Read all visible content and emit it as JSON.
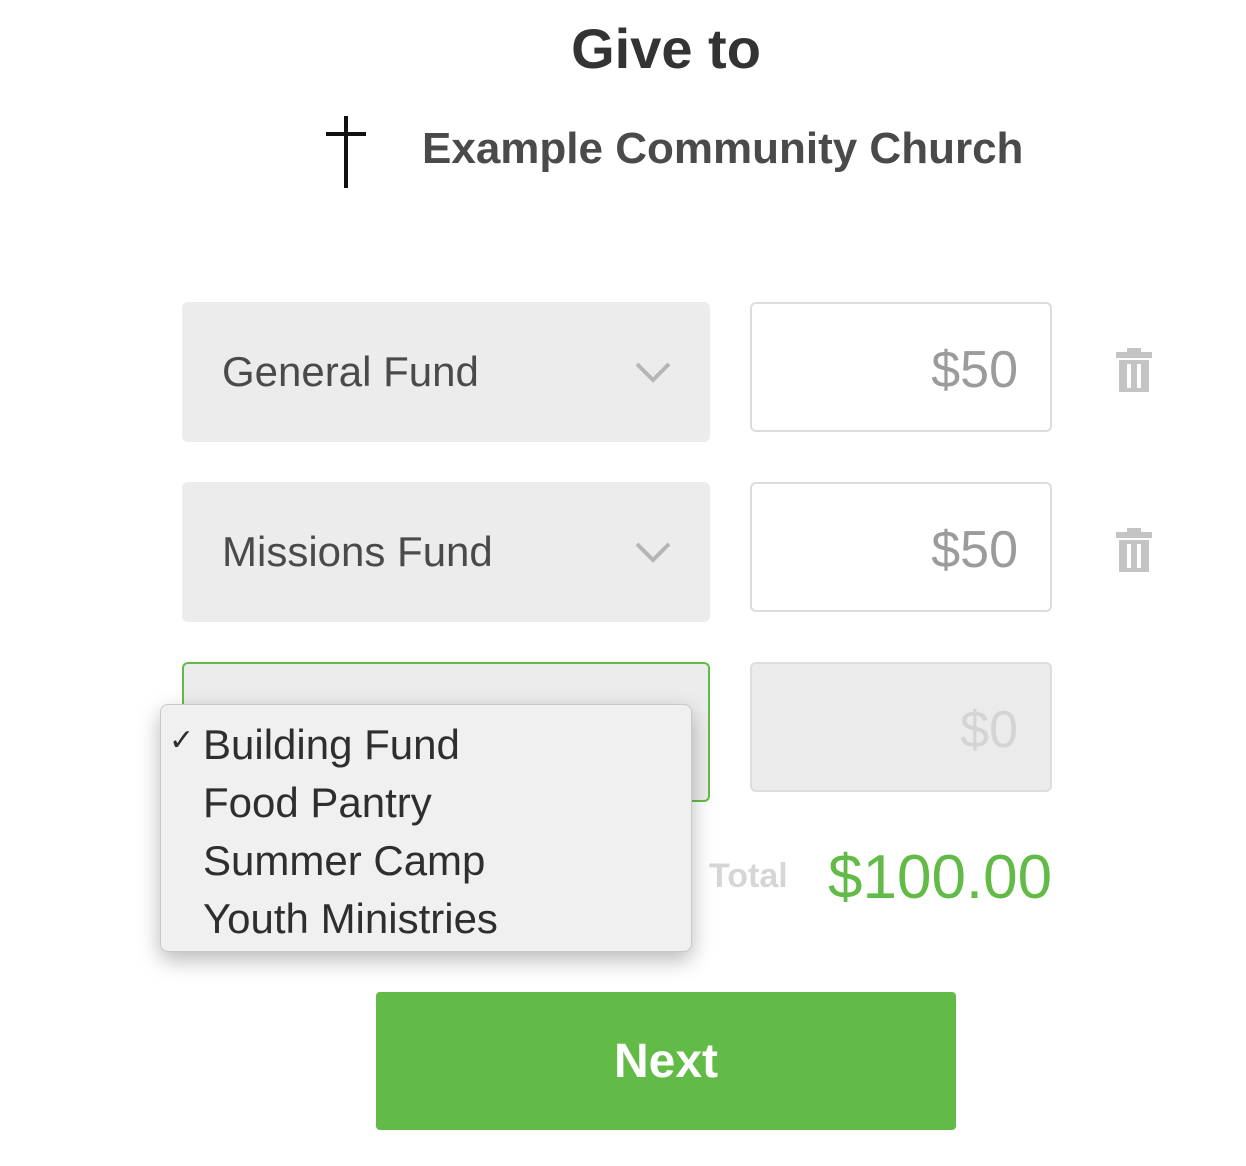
{
  "header": {
    "title": "Give to",
    "organization": "Example Community Church",
    "logo_icon": "latin-cross-icon"
  },
  "donation_rows": [
    {
      "fund": "General Fund",
      "amount": "$50",
      "removable": true
    },
    {
      "fund": "Missions Fund",
      "amount": "$50",
      "removable": true
    },
    {
      "fund": "",
      "amount": "$0",
      "removable": false
    }
  ],
  "dropdown": {
    "open": true,
    "selected": "Building Fund",
    "options": [
      "Building Fund",
      "Food Pantry",
      "Summer Camp",
      "Youth Ministries"
    ],
    "check_glyph": "✓"
  },
  "summary": {
    "total_label": "Total",
    "total_value": "$100.00"
  },
  "actions": {
    "next_label": "Next"
  },
  "colors": {
    "accent": "#63bb47",
    "text_dark": "#333333",
    "field_bg": "#ececec",
    "muted": "#9b9b9b"
  }
}
